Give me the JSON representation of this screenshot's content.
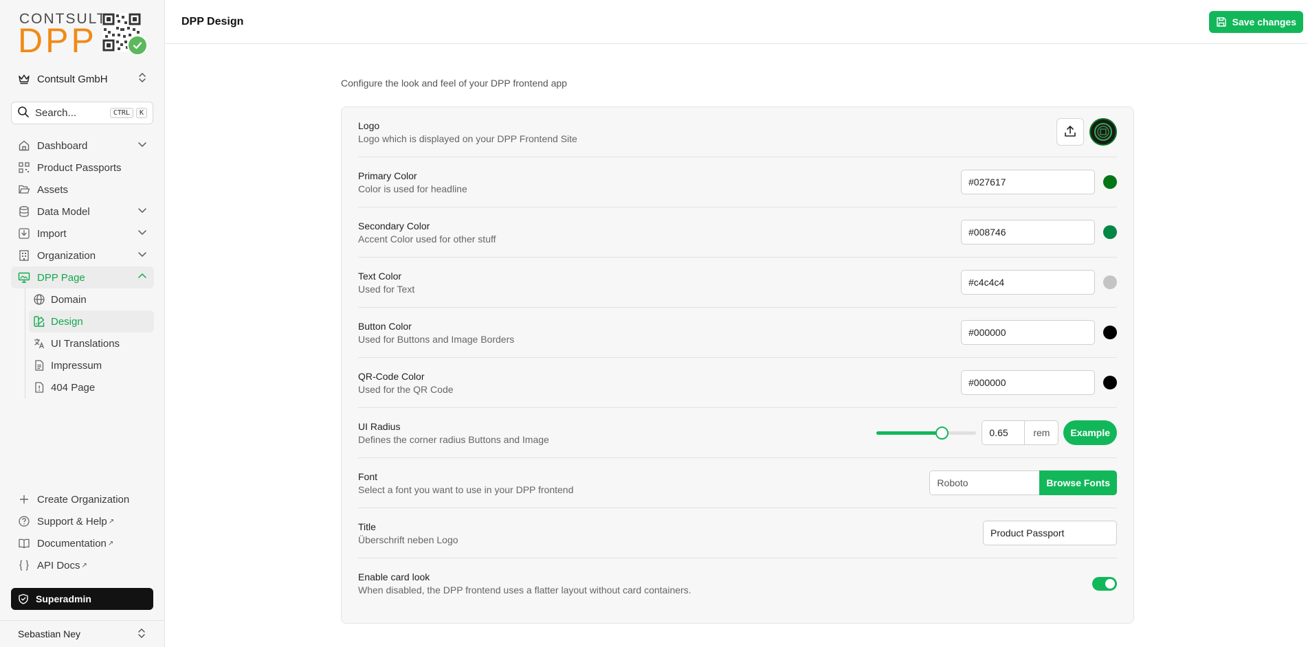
{
  "brand": {
    "logo_top": "CONTSULT",
    "logo_main": "DPP",
    "accent": "#12b75a",
    "logo_orange": "#f08a16"
  },
  "org_switcher": {
    "name": "Contsult GmbH",
    "icon": "crown-icon"
  },
  "search": {
    "placeholder": "Search...",
    "kbd1": "CTRL",
    "kbd2": "K"
  },
  "nav": {
    "dashboard": "Dashboard",
    "product_passports": "Product Passports",
    "assets": "Assets",
    "data_model": "Data Model",
    "import": "Import",
    "organization": "Organization",
    "dpp_page": "DPP Page",
    "sub": {
      "domain": "Domain",
      "design": "Design",
      "ui_translations": "UI Translations",
      "impressum": "Impressum",
      "page_404": "404 Page"
    }
  },
  "footer": {
    "create_org": "Create Organization",
    "support": "Support & Help",
    "documentation": "Documentation",
    "api_docs": "API Docs",
    "external_mark": "↗",
    "superadmin": "Superadmin",
    "user": "Sebastian Ney"
  },
  "header": {
    "title": "DPP Design",
    "save_label": "Save changes"
  },
  "intro": "Configure the look and feel of your DPP frontend app",
  "settings": {
    "logo": {
      "title": "Logo",
      "desc": "Logo which is displayed on your DPP Frontend Site"
    },
    "primary": {
      "title": "Primary Color",
      "desc": "Color is used for headline",
      "value": "#027617"
    },
    "secondary": {
      "title": "Secondary Color",
      "desc": "Accent Color used for other stuff",
      "value": "#008746"
    },
    "text": {
      "title": "Text Color",
      "desc": "Used for Text",
      "value": "#c4c4c4"
    },
    "button": {
      "title": "Button Color",
      "desc": "Used for Buttons and Image Borders",
      "value": "#000000"
    },
    "qr": {
      "title": "QR-Code Color",
      "desc": "Used for the QR Code",
      "value": "#000000"
    },
    "radius": {
      "title": "UI Radius",
      "desc": "Defines the corner radius Buttons and Image",
      "value": "0.65",
      "unit": "rem",
      "slider_fraction": 0.65,
      "example_label": "Example"
    },
    "font": {
      "title": "Font",
      "desc": "Select a font you want to use in your DPP frontend",
      "value": "Roboto",
      "browse_label": "Browse Fonts"
    },
    "title_field": {
      "title": "Title",
      "desc": "Überschrift neben Logo",
      "value": "Product Passport"
    },
    "card_look": {
      "title": "Enable card look",
      "desc": "When disabled, the DPP frontend uses a flatter layout without card containers.",
      "enabled": true
    }
  }
}
